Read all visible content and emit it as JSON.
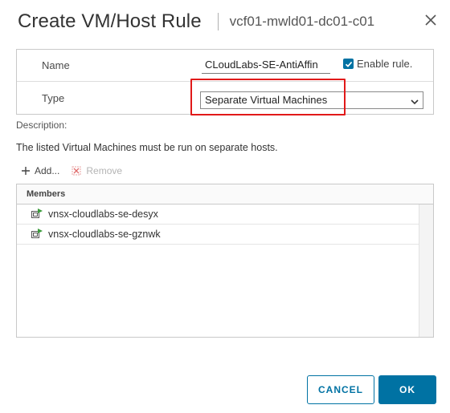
{
  "dialog": {
    "title": "Create VM/Host Rule",
    "subtitle": "vcf01-mwld01-dc01-c01",
    "close_icon": "close-icon"
  },
  "properties": {
    "name_label": "Name",
    "name_value": "CLoudLabs-SE-AntiAffin",
    "enable_label": "Enable rule.",
    "enable_checked": true,
    "type_label": "Type",
    "type_value": "Separate Virtual Machines"
  },
  "description": {
    "label": "Description:",
    "text": "The listed Virtual Machines must be run on separate hosts."
  },
  "toolbar": {
    "add_label": "Add...",
    "remove_label": "Remove"
  },
  "members": {
    "header": "Members",
    "rows": [
      {
        "name": "vnsx-cloudlabs-se-desyx",
        "icon": "vm-powered-on-icon"
      },
      {
        "name": "vnsx-cloudlabs-se-gznwk",
        "icon": "vm-powered-on-icon"
      }
    ]
  },
  "buttons": {
    "cancel": "CANCEL",
    "ok": "OK"
  },
  "colors": {
    "accent": "#0072a3",
    "highlight": "#e11919"
  }
}
